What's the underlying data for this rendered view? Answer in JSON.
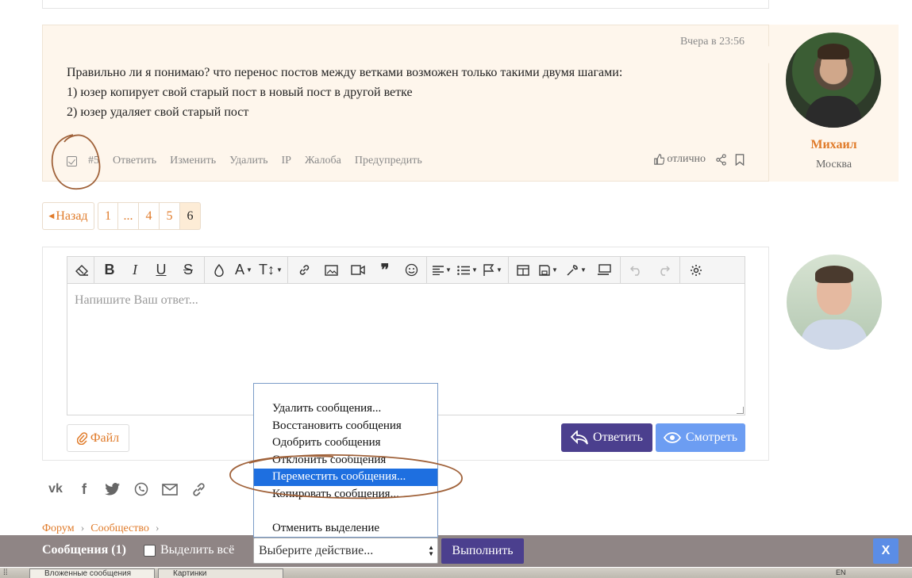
{
  "post": {
    "date": "Вчера в 23:56",
    "lines": [
      "Правильно ли я понимаю? что перенос постов между ветками возможен только такими двумя шагами:",
      "1) юзер копирует свой старый пост в новый пост в другой ветке",
      "2) юзер удаляет свой старый пост"
    ],
    "number": "#5",
    "actions": [
      "Ответить",
      "Изменить",
      "Удалить",
      "IP",
      "Жалоба",
      "Предупредить"
    ],
    "like_label": "отлично"
  },
  "user": {
    "name": "Михаил",
    "city": "Москва"
  },
  "pagination": {
    "prev": "Назад",
    "pages": [
      "1",
      "...",
      "4",
      "5",
      "6"
    ],
    "current": "6"
  },
  "editor": {
    "placeholder": "Напишите Ваш ответ...",
    "file_label": "Файл",
    "reply_label": "Ответить",
    "preview_label": "Смотреть"
  },
  "dropdown": {
    "options": [
      "Удалить сообщения...",
      "Восстановить сообщения",
      "Одобрить сообщения",
      "Отклонить сообщения",
      "Переместить сообщения...",
      "Копировать сообщения...",
      "",
      "Отменить выделение"
    ],
    "selected_index": 4
  },
  "breadcrumb": [
    "Форум",
    "Сообщество"
  ],
  "bottom_bar": {
    "title": "Сообщения (1)",
    "select_all": "Выделить всё",
    "select_value": "Выберите действие...",
    "execute": "Выполнить",
    "close": "X"
  },
  "taskbar": {
    "tasks": [
      "Вложенные сообщения",
      "Картинки"
    ],
    "tray_lang": "EN"
  },
  "colors": {
    "accent": "#e07b2a",
    "post_bg": "#fef6ec",
    "primary_button": "#4b3f8e",
    "secondary_button": "#6c9df2",
    "selection": "#1e6fe0",
    "bar": "#8f8585",
    "annotation": "#a0623a"
  }
}
